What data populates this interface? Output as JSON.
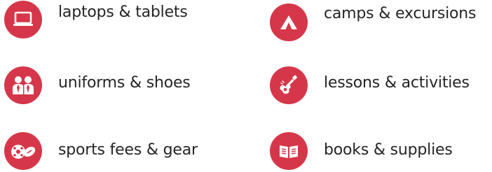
{
  "theme": {
    "accent": "#d63649",
    "text": "#252525",
    "background": "#ffffff"
  },
  "categories": [
    {
      "label": "laptops & tablets",
      "icon": "laptop-icon"
    },
    {
      "label": "uniforms & shoes",
      "icon": "uniform-people-icon"
    },
    {
      "label": "sports fees & gear",
      "icon": "sports-balls-icon"
    },
    {
      "label": "camps & excursions",
      "icon": "tent-icon"
    },
    {
      "label": "lessons & activities",
      "icon": "guitar-icon"
    },
    {
      "label": "books & supplies",
      "icon": "open-book-icon"
    }
  ]
}
